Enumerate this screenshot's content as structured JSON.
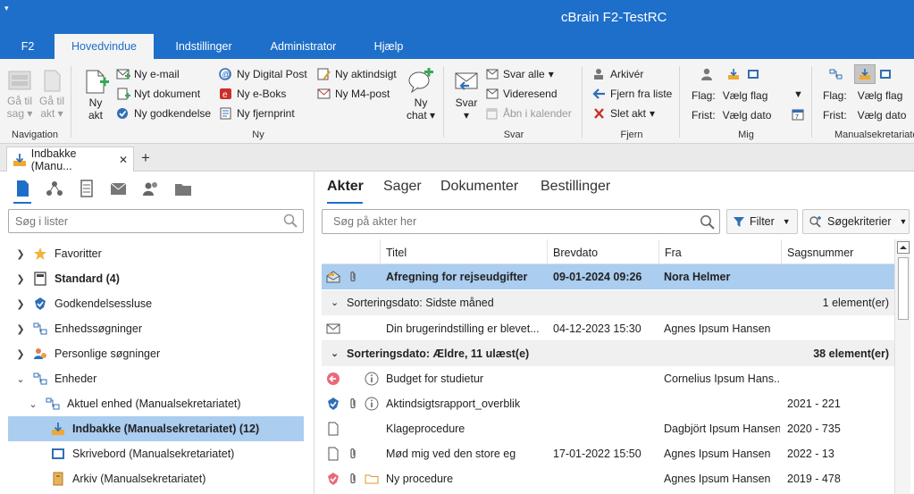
{
  "window": {
    "title": "cBrain F2-TestRC",
    "quick_access": "▾"
  },
  "ribbon_tabs": [
    {
      "label": "F2"
    },
    {
      "label": "Hovedvindue"
    },
    {
      "label": "Indstillinger"
    },
    {
      "label": "Administrator"
    },
    {
      "label": "Hjælp"
    }
  ],
  "ribbon": {
    "navigation": {
      "label": "Navigation",
      "back_line1": "Gå til",
      "back_line2": "sag",
      "fwd_line1": "Gå til",
      "fwd_line2": "akt"
    },
    "ny": {
      "label": "Ny",
      "ny_akt_line1": "Ny",
      "ny_akt_line2": "akt",
      "email": "Ny e-mail",
      "dokument": "Nyt dokument",
      "godkendelse": "Ny godkendelse",
      "digital_post": "Ny Digital Post",
      "eboks": "Ny e-Boks",
      "fjernprint": "Ny fjernprint",
      "aktindsigt": "Ny aktindsigt",
      "m4post": "Ny M4-post",
      "chat_line1": "Ny",
      "chat_line2": "chat"
    },
    "svar": {
      "label": "Svar",
      "svar": "Svar",
      "svar_alle": "Svar alle",
      "videresend": "Videresend",
      "aabn_kalender": "Åbn i kalender"
    },
    "fjern": {
      "label": "Fjern",
      "arkiver": "Arkivér",
      "fjern_fra_liste": "Fjern fra liste",
      "slet_akt": "Slet akt"
    },
    "mig": {
      "label": "Mig",
      "flag_label": "Flag:",
      "flag_value": "Vælg flag",
      "frist_label": "Frist:",
      "frist_value": "Vælg dato"
    },
    "manual": {
      "label": "Manualsekretariatet",
      "flag_label": "Flag:",
      "flag_value": "Vælg flag",
      "frist_label": "Frist:",
      "frist_value": "Vælg dato"
    }
  },
  "doc_tab": {
    "label": "Indbakke (Manu...",
    "close": "✕",
    "add": "+"
  },
  "left": {
    "search_placeholder": "Søg i lister",
    "tree": [
      {
        "label": "Favoritter"
      },
      {
        "label": "Standard (4)"
      },
      {
        "label": "Godkendelsessluse"
      },
      {
        "label": "Enhedssøgninger"
      },
      {
        "label": "Personlige søgninger"
      },
      {
        "label": "Enheder"
      },
      {
        "label": "Aktuel enhed (Manualsekretariatet)"
      },
      {
        "label": "Indbakke (Manualsekretariatet) (12)"
      },
      {
        "label": "Skrivebord (Manualsekretariatet)"
      },
      {
        "label": "Arkiv (Manualsekretariatet)"
      }
    ]
  },
  "right": {
    "tabs": [
      {
        "label": "Akter"
      },
      {
        "label": "Sager"
      },
      {
        "label": "Dokumenter"
      },
      {
        "label": "Bestillinger"
      }
    ],
    "search_placeholder": "Søg på akter her",
    "filter_label": "Filter",
    "criteria_label": "Søgekriterier",
    "columns": [
      {
        "label": "Titel"
      },
      {
        "label": "Brevdato"
      },
      {
        "label": "Fra"
      },
      {
        "label": "Sagsnummer"
      }
    ],
    "selected_row": {
      "title": "Afregning for rejseudgifter",
      "date": "09-01-2024 09:26",
      "from": "Nora Helmer",
      "case": ""
    },
    "group1": {
      "label": "Sorteringsdato:  Sidste måned",
      "count": "1 element(er)"
    },
    "row1": {
      "title": "Din brugerindstilling er blevet...",
      "date": "04-12-2023 15:30",
      "from": "Agnes Ipsum Hansen",
      "case": ""
    },
    "group2": {
      "label": "Sorteringsdato:  Ældre, 11 ulæst(e)",
      "count": "38 element(er)"
    },
    "rows": [
      {
        "title": "Budget for studietur",
        "date": "",
        "from": "Cornelius Ipsum Hans...",
        "case": ""
      },
      {
        "title": "Aktindsigtsrapport_overblik",
        "date": "",
        "from": "",
        "case": "2021 - 221"
      },
      {
        "title": "Klageprocedure",
        "date": "",
        "from": "Dagbjört Ipsum Hansen",
        "case": "2020 - 735"
      },
      {
        "title": "Mød mig ved den store eg",
        "date": "17-01-2022 15:50",
        "from": "Agnes Ipsum Hansen",
        "case": "2022 - 13"
      },
      {
        "title": "Ny procedure",
        "date": "",
        "from": "Agnes Ipsum Hansen",
        "case": "2019 - 478"
      }
    ]
  },
  "colors": {
    "accent": "#1e6fc9",
    "selection": "#aacdf0"
  }
}
